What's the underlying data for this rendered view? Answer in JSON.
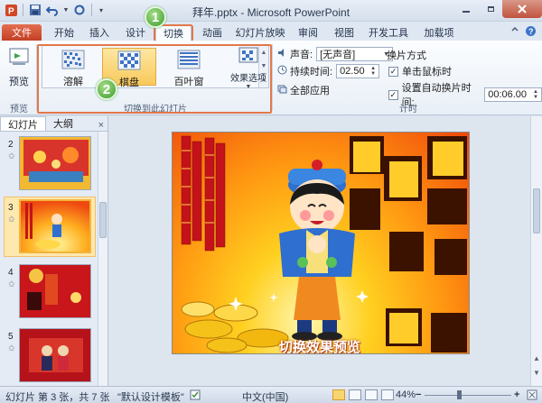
{
  "titlebar": {
    "title": "拜年.pptx - Microsoft PowerPoint"
  },
  "tabs": {
    "file": "文件",
    "items": [
      "开始",
      "插入",
      "设计",
      "切换",
      "动画",
      "幻灯片放映",
      "审阅",
      "视图",
      "开发工具",
      "加载项"
    ],
    "active": "切换"
  },
  "ribbon": {
    "preview_label": "预览",
    "preview_group_label": "预览",
    "transitions": [
      {
        "label": "溶解"
      },
      {
        "label": "棋盘"
      },
      {
        "label": "百叶窗"
      }
    ],
    "selected_transition": "棋盘",
    "effect_options_label": "效果选项",
    "transition_group_label": "切换到此幻灯片",
    "sound_label": "声音:",
    "sound_value": "[无声音]",
    "duration_label": "持续时间:",
    "duration_value": "02.50",
    "apply_all_label": "全部应用",
    "advance_label": "换片方式",
    "on_click_label": "单击鼠标时",
    "after_time_label": "设置自动换片时间:",
    "after_time_value": "00:06.00",
    "timing_group_label": "计时"
  },
  "callouts": {
    "first": "1",
    "second": "2"
  },
  "leftpane": {
    "tab_slides": "幻灯片",
    "tab_outline": "大纲",
    "close_glyph": "×",
    "thumbnails": [
      {
        "num": "2",
        "star": "✩"
      },
      {
        "num": "3",
        "star": "✩"
      },
      {
        "num": "4",
        "star": "✩"
      },
      {
        "num": "5",
        "star": "✩"
      }
    ]
  },
  "slide": {
    "caption": "切换效果预览"
  },
  "statusbar": {
    "slide_info": "幻灯片 第 3 张，共 7 张",
    "theme": "\"默认设计模板\"",
    "language": "中文(中国)",
    "zoom": "44%",
    "zoom_out": "−",
    "zoom_in": "+"
  },
  "colors": {
    "accent_orange": "#e2784a",
    "file_tab": "#c33f24",
    "selected_item": "#f8c95b"
  }
}
